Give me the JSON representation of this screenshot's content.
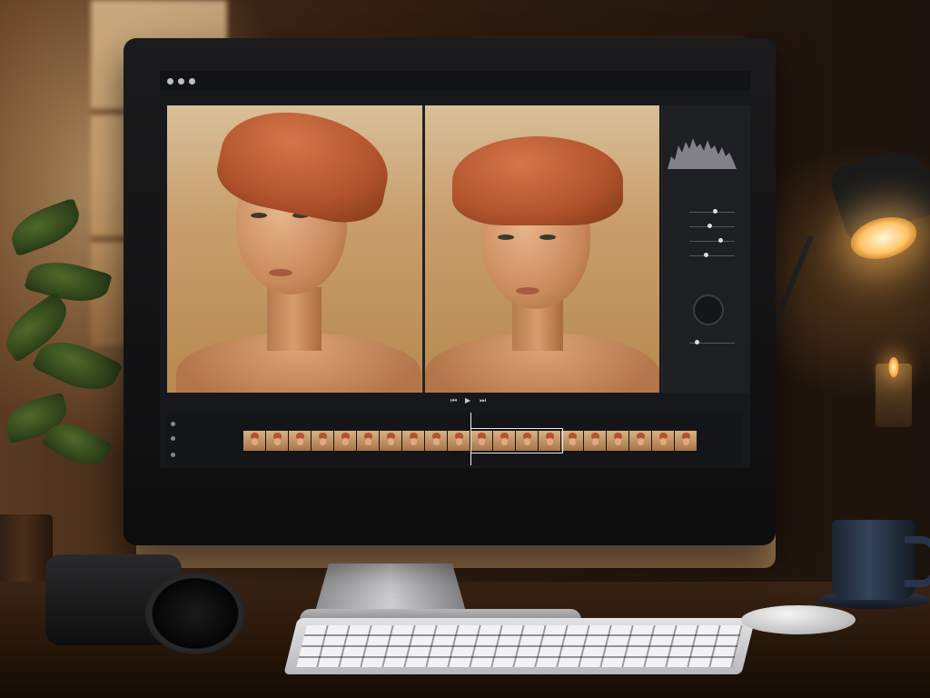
{
  "scene": {
    "description_visible_text": ""
  },
  "editor": {
    "panel_title": "",
    "slider_labels": [
      "",
      "",
      "",
      "",
      ""
    ],
    "track_labels": [
      "",
      "",
      ""
    ]
  },
  "colors": {
    "accent_ui": "#e8e8e8",
    "turban": "#b5532c",
    "lamp_glow": "#ffc56a"
  },
  "icons": [
    "traffic-light-dots",
    "play-icon",
    "rewind-icon",
    "forward-icon",
    "histogram-graph",
    "rotation-dial"
  ]
}
